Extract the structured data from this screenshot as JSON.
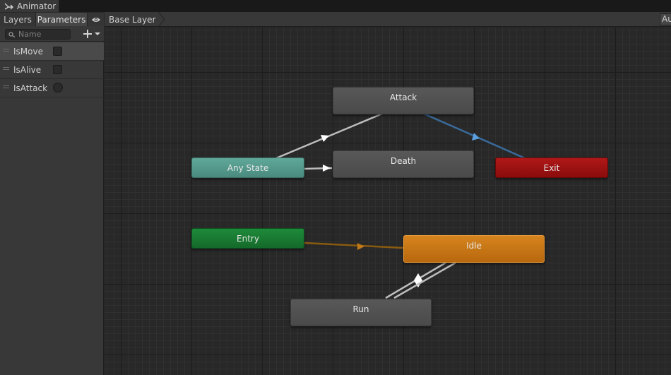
{
  "window": {
    "title": "Animator"
  },
  "left_panel": {
    "tabs": [
      {
        "label": "Layers"
      },
      {
        "label": "Parameters"
      }
    ],
    "search": {
      "placeholder": "Name",
      "value": ""
    },
    "parameters": [
      {
        "name": "IsMove",
        "type": "bool",
        "value": false,
        "selected": true
      },
      {
        "name": "IsAlive",
        "type": "bool",
        "value": false,
        "selected": false
      },
      {
        "name": "IsAttack",
        "type": "trigger",
        "value": false,
        "selected": false
      }
    ]
  },
  "breadcrumb": {
    "layer": "Base Layer",
    "auto_live_label": "Au"
  },
  "graph": {
    "states": {
      "attack": "Attack",
      "death": "Death",
      "any_state": "Any State",
      "exit": "Exit",
      "entry": "Entry",
      "idle": "Idle",
      "run": "Run"
    },
    "colors": {
      "normal_state": "#555555",
      "default_state": "#c87618",
      "any_state": "#55998c",
      "entry": "#1a7a34",
      "exit": "#a01212",
      "transition": "#bdbdbd",
      "entry_transition": "#8a5a10",
      "exit_transition": "#3a6a9a"
    }
  }
}
